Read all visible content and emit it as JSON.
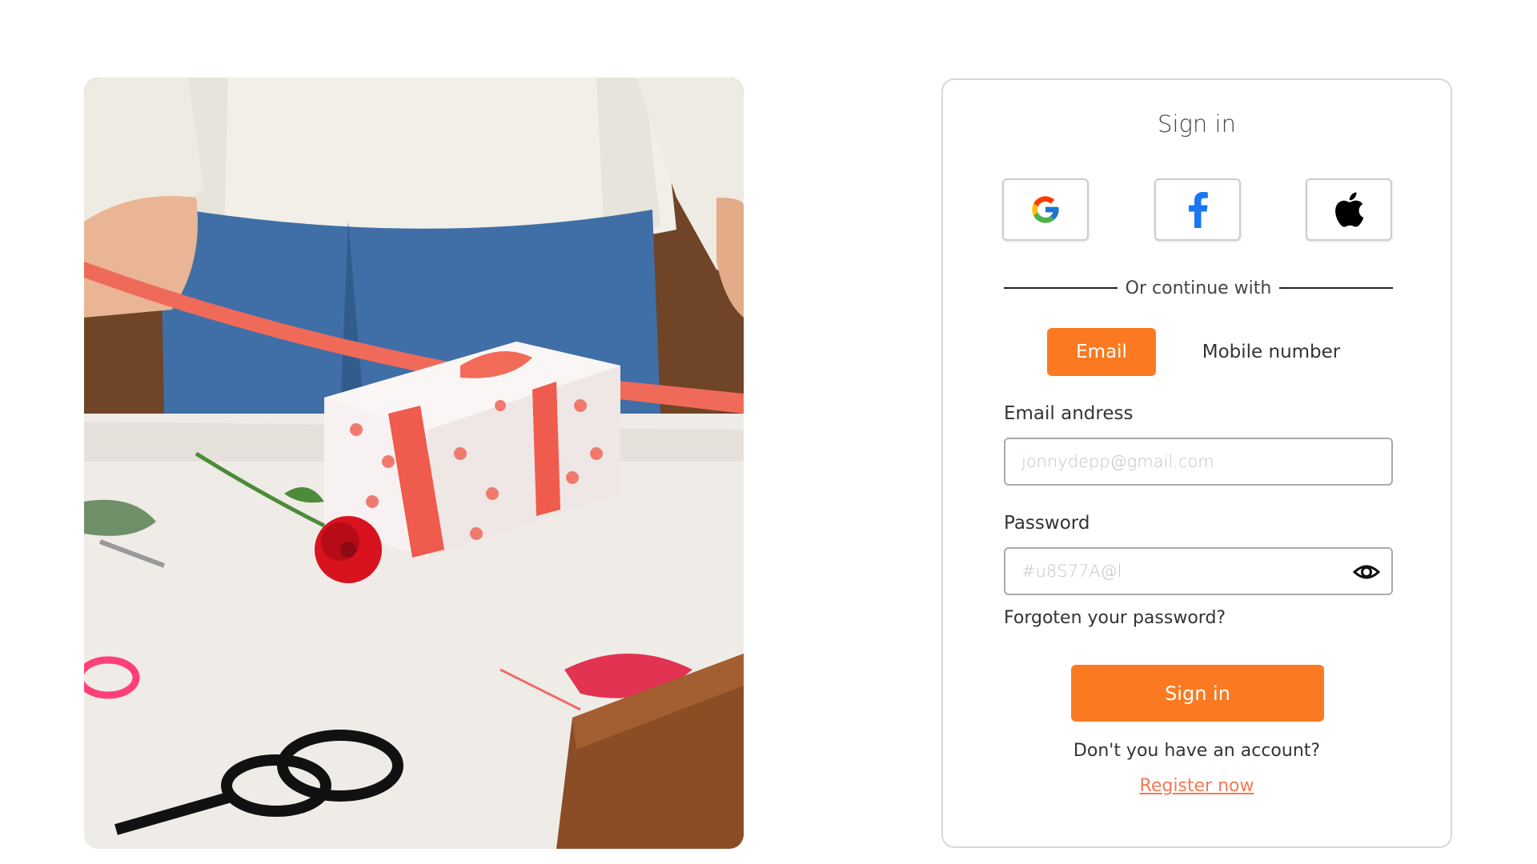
{
  "photo": {
    "description_icon": "gift-wrapping-photo"
  },
  "signin": {
    "title": "Sign in",
    "social": [
      {
        "name": "google",
        "icon": "google-icon"
      },
      {
        "name": "facebook",
        "icon": "facebook-icon"
      },
      {
        "name": "apple",
        "icon": "apple-icon"
      }
    ],
    "divider_text": "Or continue with",
    "tabs": {
      "email": "Email",
      "mobile": "Mobile number",
      "active": "email"
    },
    "email_label": "Email andress",
    "email_placeholder": "jonnydepp@gmail.com",
    "password_label": "Password",
    "password_placeholder": "#u8S77A@l",
    "forgot": "Forgoten your password?",
    "submit": "Sign in",
    "no_account": "Don't you have an account?",
    "register": "Register now"
  },
  "colors": {
    "accent": "#fb7a21",
    "link": "#f47a55",
    "border": "#d9d9d9"
  }
}
